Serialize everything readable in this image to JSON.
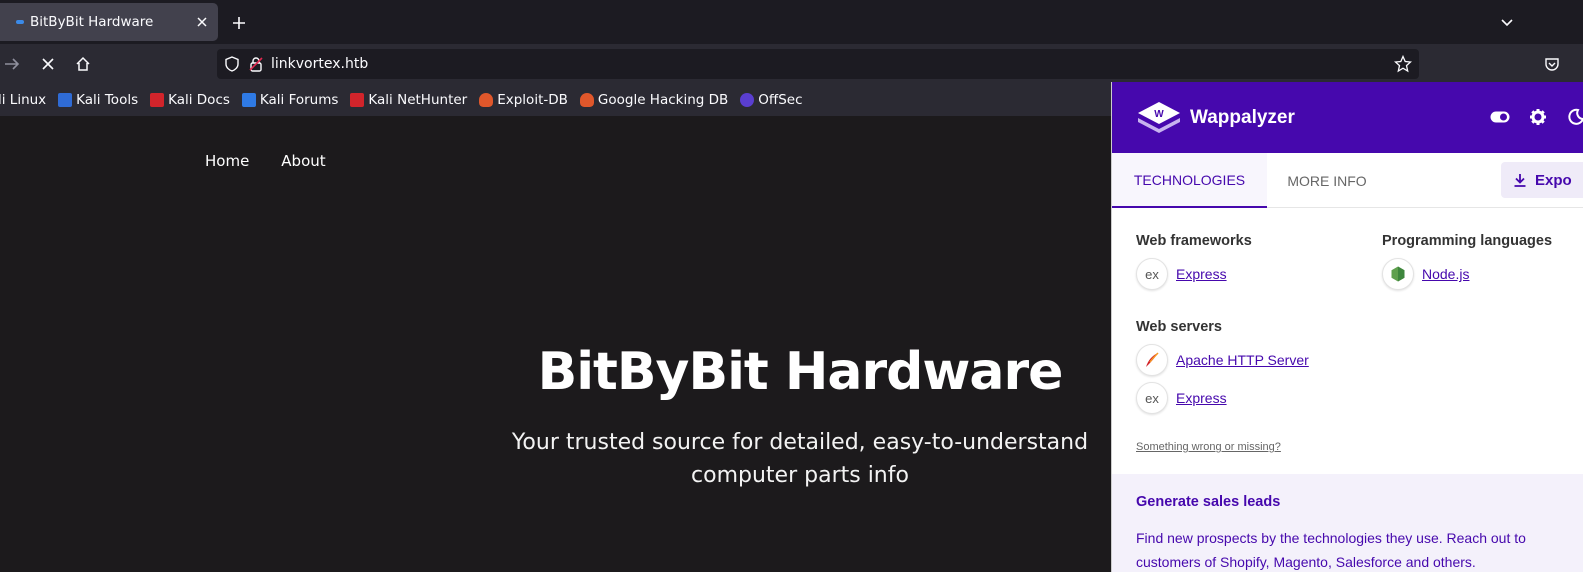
{
  "browser": {
    "tab_title": "BitByBit Hardware",
    "url": "linkvortex.htb",
    "bookmarks": [
      {
        "label": "li Linux",
        "color": "#3a6fd8"
      },
      {
        "label": "Kali Tools",
        "color": "#2f6bd5"
      },
      {
        "label": "Kali Docs",
        "color": "#d2242b"
      },
      {
        "label": "Kali Forums",
        "color": "#2f7ae5"
      },
      {
        "label": "Kali NetHunter",
        "color": "#d2242b"
      },
      {
        "label": "Exploit-DB",
        "color": "#e0572b"
      },
      {
        "label": "Google Hacking DB",
        "color": "#e0572b"
      },
      {
        "label": "OffSec",
        "color": "#5a3ed0"
      }
    ]
  },
  "site": {
    "nav": [
      "Home",
      "About"
    ],
    "hero_title": "BitByBit Hardware",
    "hero_subtitle_line1": "Your trusted source for detailed, easy-to-understand",
    "hero_subtitle_line2": "computer parts info"
  },
  "wappalyzer": {
    "brand": "Wappalyzer",
    "tabs": [
      "TECHNOLOGIES",
      "MORE INFO"
    ],
    "export_label": "Expo",
    "categories": [
      {
        "title": "Web frameworks",
        "items": [
          {
            "name": "Express",
            "icon": "express-icon"
          }
        ]
      },
      {
        "title": "Programming languages",
        "items": [
          {
            "name": "Node.js",
            "icon": "nodejs-icon"
          }
        ]
      },
      {
        "title": "Web servers",
        "items": [
          {
            "name": "Apache HTTP Server",
            "icon": "apache-icon"
          },
          {
            "name": "Express",
            "icon": "express-icon"
          }
        ]
      }
    ],
    "wrong_link": "Something wrong or missing?",
    "promo_title": "Generate sales leads",
    "promo_text": "Find new prospects by the technologies they use. Reach out to customers of Shopify, Magento, Salesforce and others."
  },
  "colors": {
    "wappalyzer_purple": "#4608ad",
    "browser_dark": "#1c1b22",
    "toolbar": "#2b2a33"
  }
}
